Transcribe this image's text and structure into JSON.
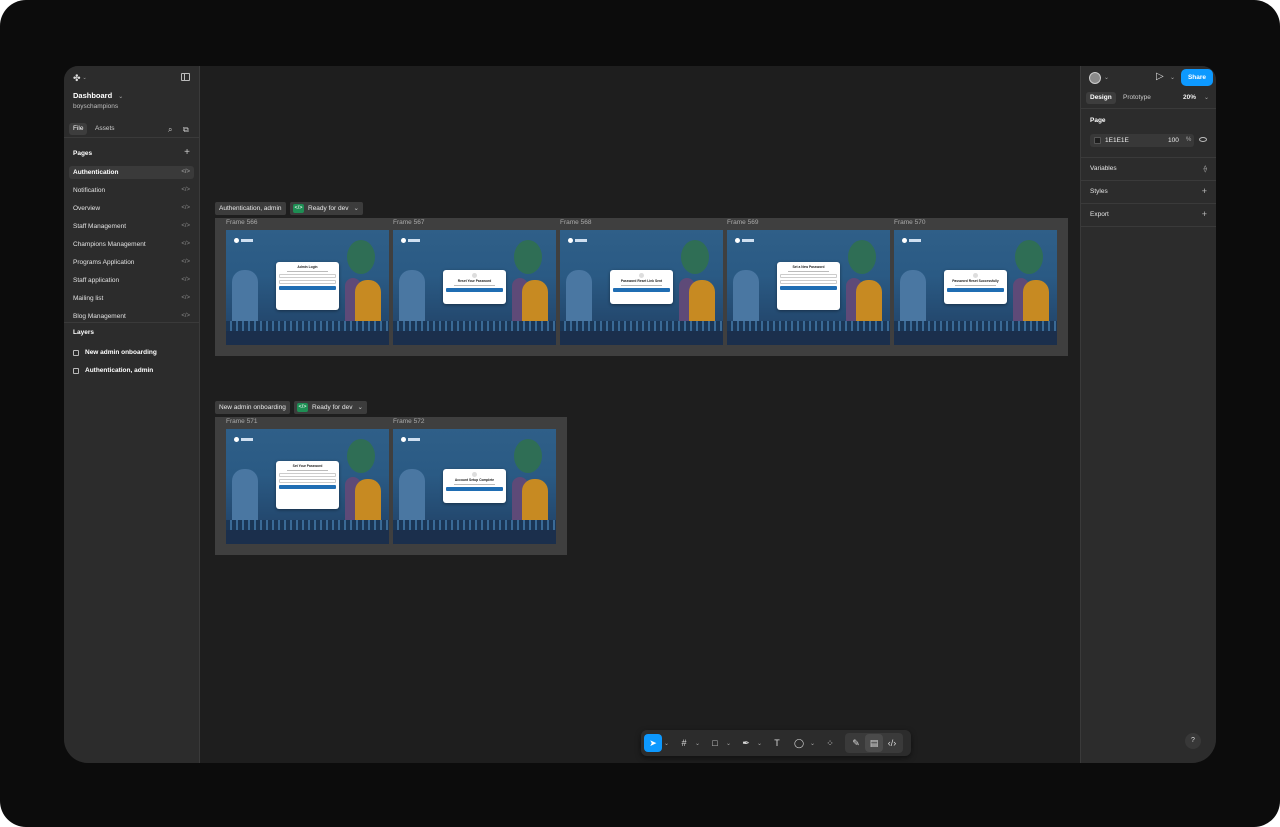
{
  "project": {
    "name": "Dashboard",
    "team": "boyschampions"
  },
  "left_panel": {
    "tabs": [
      "File",
      "Assets"
    ],
    "pages_title": "Pages",
    "pages": [
      "Authentication",
      "Notification",
      "Overview",
      "Staff Management",
      "Champions Management",
      "Programs Application",
      "Staff application",
      "Mailing list",
      "Blog Management"
    ],
    "selected_page": "Authentication",
    "layers_title": "Layers",
    "layers": [
      "New admin onboarding",
      "Authentication, admin"
    ]
  },
  "canvas": {
    "sections": [
      {
        "label": "Authentication, admin",
        "status": "Ready for dev",
        "frames": [
          {
            "title": "Frame 566",
            "card": "Admin Login"
          },
          {
            "title": "Frame 567",
            "card": "Reset Your Password"
          },
          {
            "title": "Frame 568",
            "card": "Password Reset Link Sent"
          },
          {
            "title": "Frame 569",
            "card": "Set a New Password"
          },
          {
            "title": "Frame 570",
            "card": "Password Reset Successfully"
          }
        ]
      },
      {
        "label": "New admin onboarding",
        "status": "Ready for dev",
        "frames": [
          {
            "title": "Frame 571",
            "card": "Set Your Password"
          },
          {
            "title": "Frame 572",
            "card": "Account Setup Complete"
          }
        ]
      }
    ]
  },
  "right_panel": {
    "share_label": "Share",
    "tabs": [
      "Design",
      "Prototype"
    ],
    "zoom": "20%",
    "page_title": "Page",
    "fill_hex": "1E1E1E",
    "fill_opacity": "100",
    "fill_unit": "%",
    "rows": [
      "Variables",
      "Styles",
      "Export"
    ]
  },
  "help_label": "?",
  "colors": {
    "accent": "#0d99ff",
    "ready_green": "#1e8e54",
    "canvas": "#1e1e1e",
    "panel": "#2c2c2c"
  }
}
